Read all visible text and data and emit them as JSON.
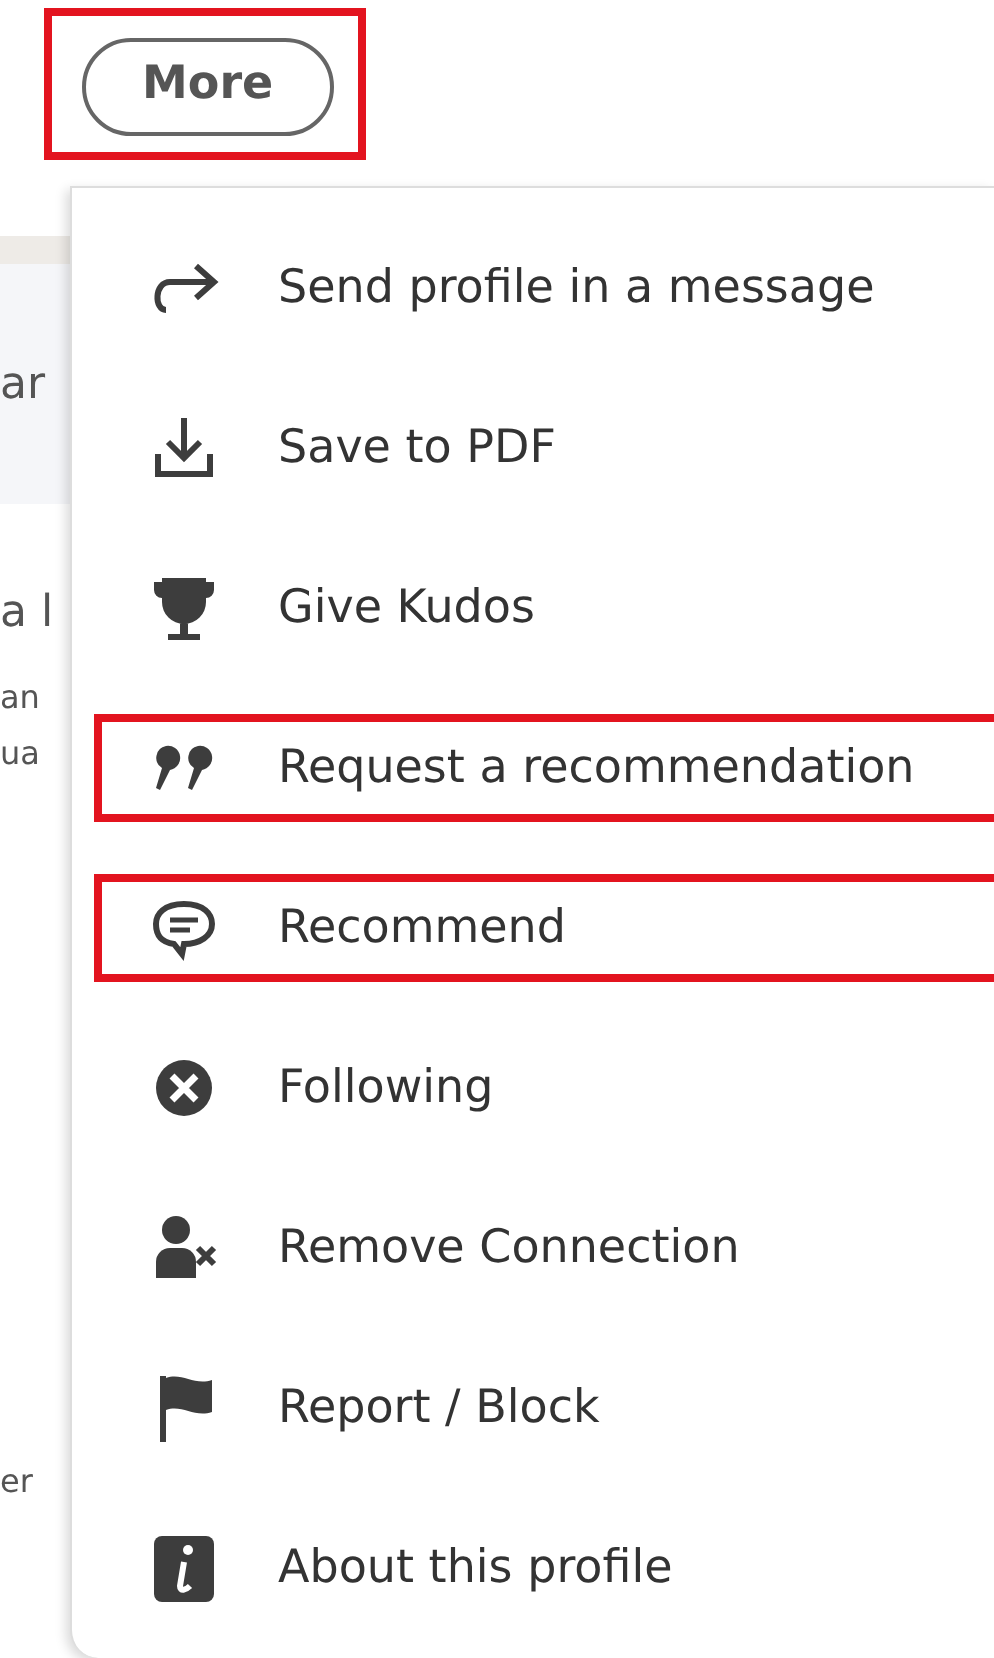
{
  "more_button": {
    "label": "More",
    "highlighted": true
  },
  "background_fragments": [
    "ar",
    "a l",
    "an",
    "ua",
    "er"
  ],
  "menu": {
    "items": [
      {
        "kind": "share",
        "label": "Send profile in a message",
        "highlighted": false
      },
      {
        "kind": "download",
        "label": "Save to PDF",
        "highlighted": false
      },
      {
        "kind": "trophy",
        "label": "Give Kudos",
        "highlighted": false
      },
      {
        "kind": "quote",
        "label": "Request a recommendation",
        "highlighted": true
      },
      {
        "kind": "speech",
        "label": "Recommend",
        "highlighted": true
      },
      {
        "kind": "unfollow",
        "label": "Following",
        "highlighted": false
      },
      {
        "kind": "remove",
        "label": "Remove Connection",
        "highlighted": false
      },
      {
        "kind": "report",
        "label": "Report / Block",
        "highlighted": false
      },
      {
        "kind": "info",
        "label": "About this profile",
        "highlighted": false
      }
    ]
  }
}
